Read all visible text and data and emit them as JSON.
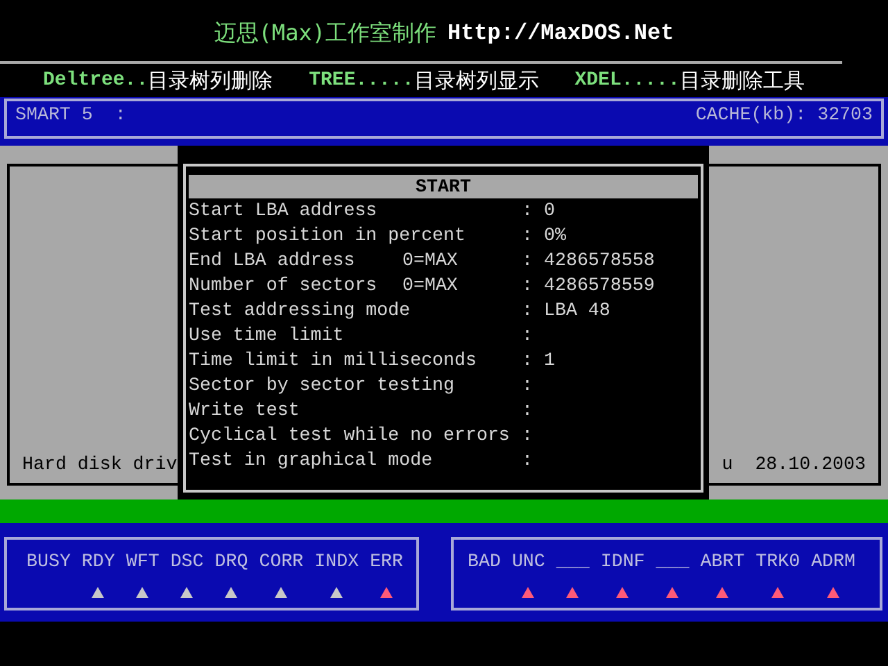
{
  "banner": {
    "title": "迈思(Max)工作室制作",
    "url": "Http://MaxDOS.Net"
  },
  "commands": [
    {
      "command": "Deltree..",
      "description": "目录树列删除"
    },
    {
      "command": "TREE.....",
      "description": "目录树列显示"
    },
    {
      "command": "XDEL.....",
      "description": "目录删除工具"
    }
  ],
  "status_bar": {
    "smart": "SMART 5  :",
    "cache": "CACHE(kb): 32703"
  },
  "background_panel": {
    "left_text": "Hard disk driv",
    "right_text": "u  28.10.2003"
  },
  "dialog": {
    "title": "START",
    "rows": [
      {
        "label": "Start LBA address",
        "colon": ":",
        "value": "0"
      },
      {
        "label": "Start position in percent",
        "colon": ":",
        "value": "0%"
      },
      {
        "label": "End LBA address",
        "hint": "0=MAX",
        "colon": ":",
        "value": "4286578558"
      },
      {
        "label": "Number of sectors",
        "hint": "0=MAX",
        "colon": ":",
        "value": "4286578559"
      },
      {
        "label": "Test addressing mode",
        "colon": ":",
        "value": "LBA 48"
      },
      {
        "label": "Use time limit",
        "colon": ":"
      },
      {
        "label": "Time limit in milliseconds",
        "colon": ":",
        "value": "1"
      },
      {
        "label": "Sector by sector testing",
        "colon": ":"
      },
      {
        "label": "Write test",
        "colon": ":"
      },
      {
        "label": "Cyclical test while no errors",
        "colon": ":"
      },
      {
        "label": "Test in graphical mode",
        "colon": ":"
      }
    ]
  },
  "status_register": [
    {
      "label": "BUSY"
    },
    {
      "label": "RDY",
      "color": "#c8c8c8"
    },
    {
      "label": "WFT",
      "color": "#c8c8c8"
    },
    {
      "label": "DSC",
      "color": "#c8c8c8"
    },
    {
      "label": "DRQ",
      "color": "#c8c8c8"
    },
    {
      "label": "CORR",
      "color": "#c8c8c8"
    },
    {
      "label": "INDX",
      "color": "#c8c8c8"
    },
    {
      "label": "ERR",
      "color": "#ff5a78"
    }
  ],
  "error_register": [
    {
      "label": "BAD"
    },
    {
      "label": "UNC",
      "color": "#ff5a78"
    },
    {
      "label": "___",
      "color": "#ff5a78"
    },
    {
      "label": "IDNF",
      "color": "#ff5a78"
    },
    {
      "label": "___",
      "color": "#ff5a78"
    },
    {
      "label": "ABRT",
      "color": "#ff5a78"
    },
    {
      "label": "TRK0",
      "color": "#ff5a78"
    },
    {
      "label": "ADRM",
      "color": "#ff5a78"
    }
  ]
}
